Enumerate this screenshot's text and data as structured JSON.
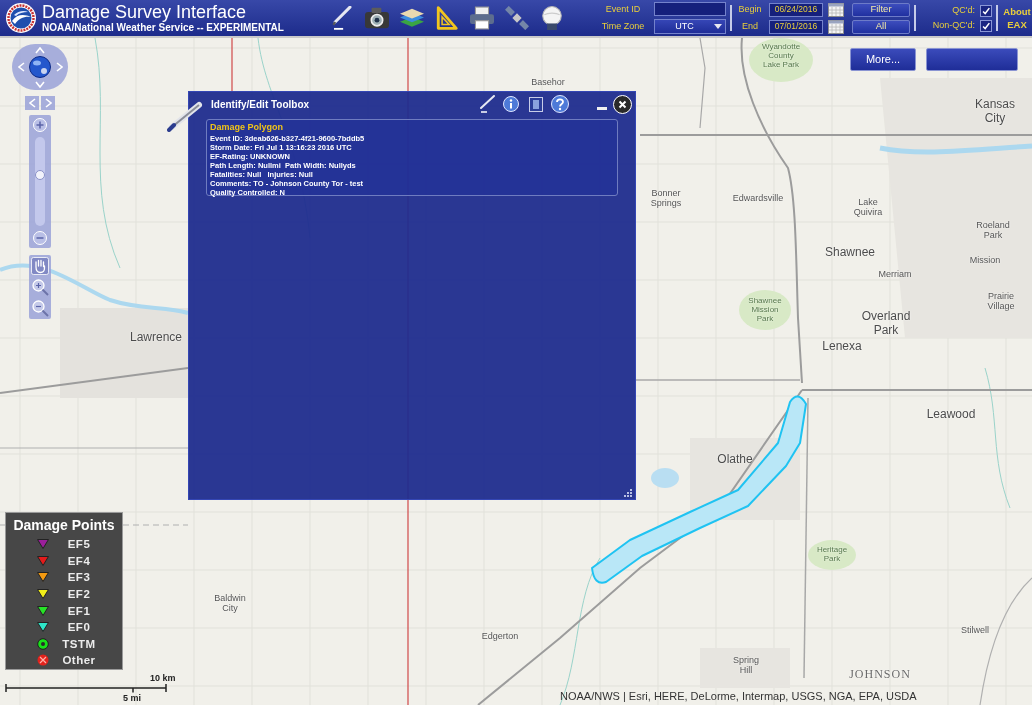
{
  "header": {
    "title": "Damage Survey Interface",
    "subtitle": "NOAA/National Weather Service -- EXPERIMENTAL"
  },
  "filters": {
    "event_id": {
      "label": "Event ID"
    },
    "time_zone": {
      "label": "Time Zone",
      "value": "UTC"
    },
    "begin": {
      "label": "Begin",
      "value": "06/24/2016"
    },
    "end": {
      "label": "End",
      "value": "07/01/2016"
    },
    "buttons": [
      "Filter",
      "All"
    ],
    "qc": [
      {
        "label": "QC'd:",
        "checked": true
      },
      {
        "label": "Non-QC'd:",
        "checked": true
      }
    ]
  },
  "about": {
    "label": "About",
    "office": "EAX"
  },
  "map_buttons": [
    "More..."
  ],
  "navigation": {
    "zoom_slider": {
      "level": 0.57
    }
  },
  "toolbox": {
    "title": "Identify/Edit Toolbox",
    "heading": "Damage Polygon",
    "lines": [
      "Event ID: 3deab626-b327-4f21-9600-7bddb5",
      "Storm Date: Fri Jul 1 13:16:23 2016 UTC",
      "EF-Rating: UNKNOWN",
      "Path Length: Nullmi  Path Width: Nullyds",
      "Fatalities: Null   Injuries: Null",
      "Comments: TO - Johnson County Tor - test",
      "Quality Controlled: N"
    ]
  },
  "legend": {
    "title": "Damage Points",
    "items": [
      {
        "label": "EF5",
        "kind": "triangle",
        "color": "#9b1f9b"
      },
      {
        "label": "EF4",
        "kind": "triangle",
        "color": "#e31b1b"
      },
      {
        "label": "EF3",
        "kind": "triangle",
        "color": "#f39a12"
      },
      {
        "label": "EF2",
        "kind": "triangle",
        "color": "#f2ef1a"
      },
      {
        "label": "EF1",
        "kind": "triangle",
        "color": "#27e227"
      },
      {
        "label": "EF0",
        "kind": "triangle",
        "color": "#2ee6c8"
      },
      {
        "label": "TSTM",
        "kind": "ring",
        "color": "#19e019"
      },
      {
        "label": "Other",
        "kind": "hatched",
        "color": "#e3221c"
      }
    ]
  },
  "scale_bar": {
    "km": "10 km",
    "mi": "5 mi"
  },
  "map_labels": [
    {
      "text": "Basehor",
      "kind": "town"
    },
    {
      "text": "Wyandotte County Lake Park",
      "kind": "park"
    },
    {
      "text": "Kansas City",
      "kind": "city"
    },
    {
      "text": "Bonner Springs",
      "kind": "town"
    },
    {
      "text": "Edwardsville",
      "kind": "town"
    },
    {
      "text": "Lake Quivira",
      "kind": "town"
    },
    {
      "text": "Roeland Park",
      "kind": "town"
    },
    {
      "text": "Shawnee",
      "kind": "city"
    },
    {
      "text": "Mission",
      "kind": "town"
    },
    {
      "text": "Merriam",
      "kind": "town"
    },
    {
      "text": "Prairie Village",
      "kind": "town"
    },
    {
      "text": "Shawnee Mission Park",
      "kind": "park"
    },
    {
      "text": "Overland Park",
      "kind": "city"
    },
    {
      "text": "Lawrence",
      "kind": "city"
    },
    {
      "text": "Lenexa",
      "kind": "city"
    },
    {
      "text": "Leawood",
      "kind": "city"
    },
    {
      "text": "Olathe",
      "kind": "city"
    },
    {
      "text": "Heritage Park",
      "kind": "park"
    },
    {
      "text": "Baldwin City",
      "kind": "town"
    },
    {
      "text": "Edgerton",
      "kind": "town"
    },
    {
      "text": "Stilwell",
      "kind": "town"
    },
    {
      "text": "Spring Hill",
      "kind": "town"
    },
    {
      "text": "JOHNSON",
      "kind": "county"
    }
  ],
  "attribution": "NOAA/NWS | Esri, HERE, DeLorme, Intermap, USGS, NGA, EPA, USDA"
}
